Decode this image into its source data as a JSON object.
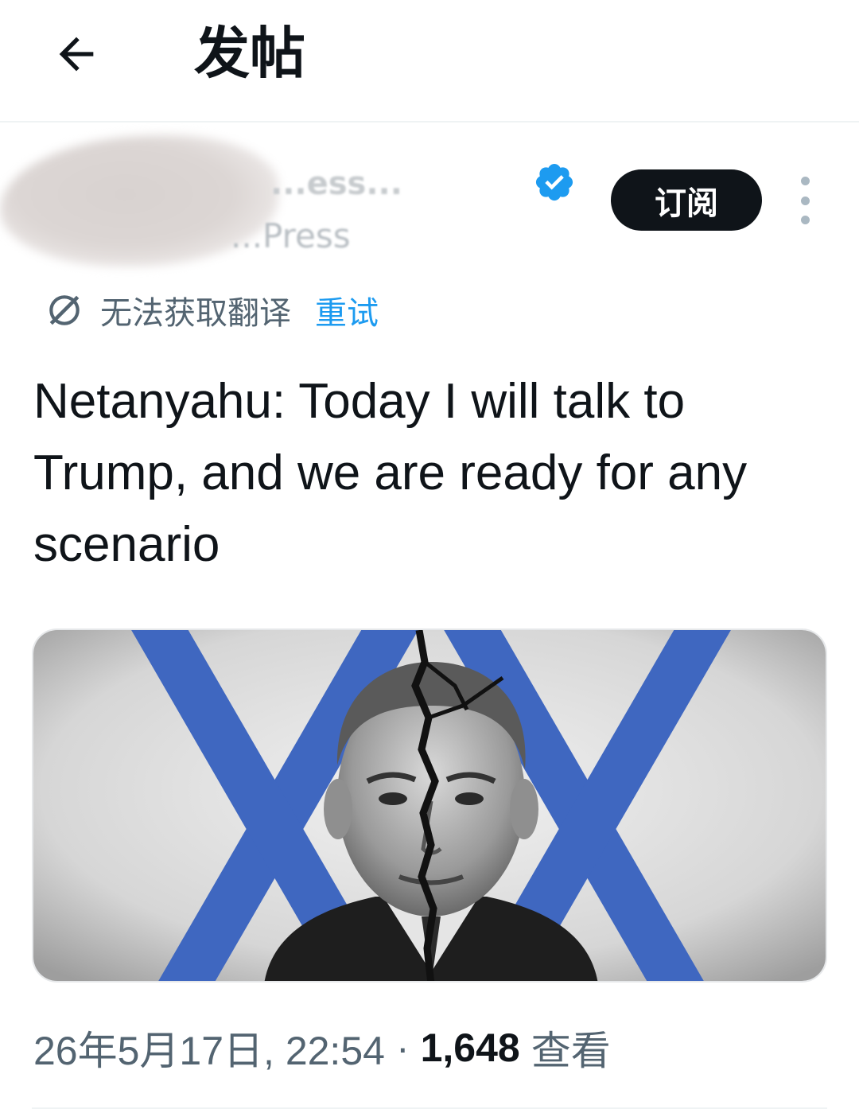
{
  "header": {
    "back_icon": "arrow-left-icon",
    "title": "发帖"
  },
  "author": {
    "name": "...ess...",
    "handle": "...Press",
    "verified_icon": "verified-badge-icon",
    "verified_color": "#1d9bf0",
    "subscribe_label": "订阅",
    "more_icon": "more-vertical-icon"
  },
  "translation": {
    "icon": "translate-off-icon",
    "status": "无法获取翻译",
    "retry_label": "重试",
    "link_color": "#1d9bf0"
  },
  "tweet": {
    "text": "Netanyahu: Today I will talk to Trump, and we are ready for any scenario",
    "image": "photo-of-netanyahu-with-cracked-face-over-star-of-david"
  },
  "meta": {
    "timestamp": "26年5月17日, 22:54",
    "separator": "·",
    "views_count": "1,648",
    "views_label": "查看"
  }
}
